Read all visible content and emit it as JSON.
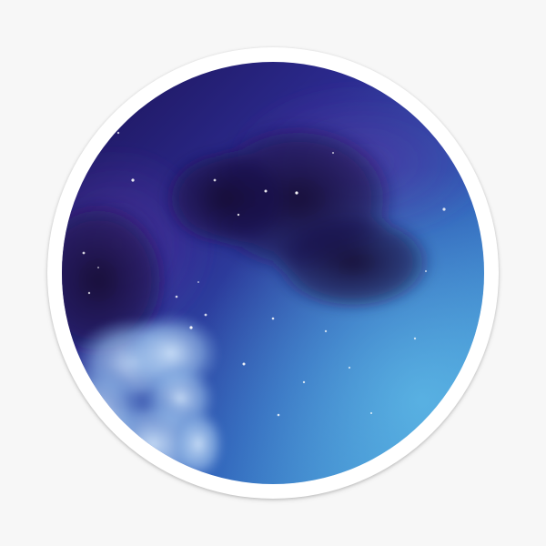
{
  "image": {
    "subject": "night-sky-sticker",
    "colors": {
      "page_background": "#f7f7f7",
      "sticker_border": "#ffffff",
      "sky_top": "#22105a",
      "sky_mid": "#2a3fa3",
      "sky_bottom": "#3b8ed3",
      "cloud_dark": "#1a1040",
      "cloud_light": "#b9d3f3"
    }
  }
}
